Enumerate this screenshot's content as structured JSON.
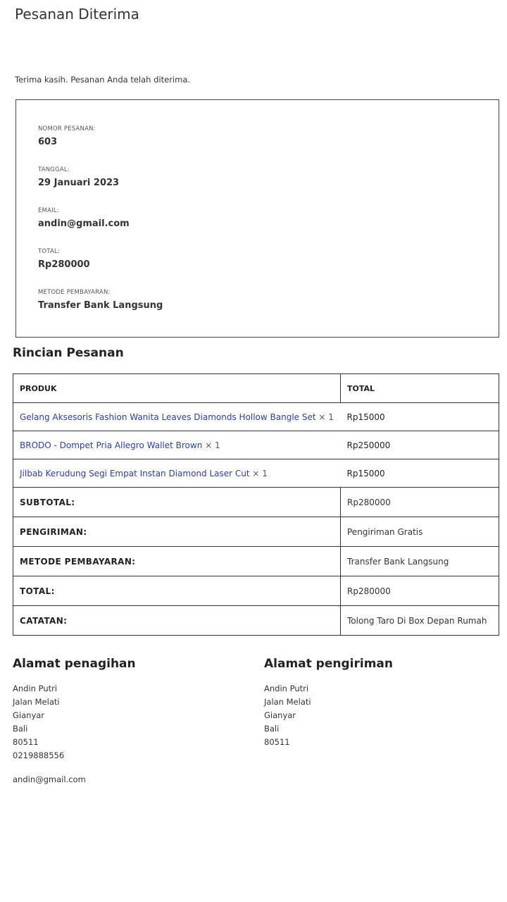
{
  "page": {
    "title": "Pesanan Diterima",
    "thank_you": "Terima kasih. Pesanan Anda telah diterima."
  },
  "overview": [
    {
      "label": "NOMOR PESANAN:",
      "value": "603"
    },
    {
      "label": "TANGGAL:",
      "value": "29 Januari 2023"
    },
    {
      "label": "EMAIL:",
      "value": "andin@gmail.com"
    },
    {
      "label": "TOTAL:",
      "value": "Rp280000"
    },
    {
      "label": "METODE PEMBAYARAN:",
      "value": "Transfer Bank Langsung"
    }
  ],
  "details": {
    "title": "Rincian Pesanan",
    "headers": {
      "product": "PRODUK",
      "total": "TOTAL"
    },
    "items": [
      {
        "name": "Gelang Aksesoris Fashion Wanita Leaves Diamonds Hollow Bangle Set",
        "qty": "× 1",
        "total": "Rp15000"
      },
      {
        "name": "BRODO - Dompet Pria Allegro Wallet Brown",
        "qty": "× 1",
        "total": "Rp250000"
      },
      {
        "name": "Jilbab Kerudung Segi Empat Instan Diamond Laser Cut",
        "qty": "× 1",
        "total": "Rp15000"
      }
    ],
    "footer": [
      {
        "label": "SUBTOTAL:",
        "value": "Rp280000"
      },
      {
        "label": "PENGIRIMAN:",
        "value": "Pengiriman Gratis"
      },
      {
        "label": "METODE PEMBAYARAN:",
        "value": "Transfer Bank Langsung"
      },
      {
        "label": "TOTAL:",
        "value": "Rp280000"
      },
      {
        "label": "CATATAN:",
        "value": "Tolong Taro Di Box Depan Rumah"
      }
    ]
  },
  "billing": {
    "title": "Alamat penagihan",
    "name": "Andin Putri",
    "street": "Jalan Melati",
    "city": "Gianyar",
    "province": "Bali",
    "postcode": "80511",
    "phone": "0219888556",
    "email": "andin@gmail.com"
  },
  "shipping": {
    "title": "Alamat pengiriman",
    "name": "Andin Putri",
    "street": "Jalan Melati",
    "city": "Gianyar",
    "province": "Bali",
    "postcode": "80511"
  },
  "colors": {
    "link": "#2a3fa8",
    "border": "#333333",
    "text": "#222222"
  }
}
